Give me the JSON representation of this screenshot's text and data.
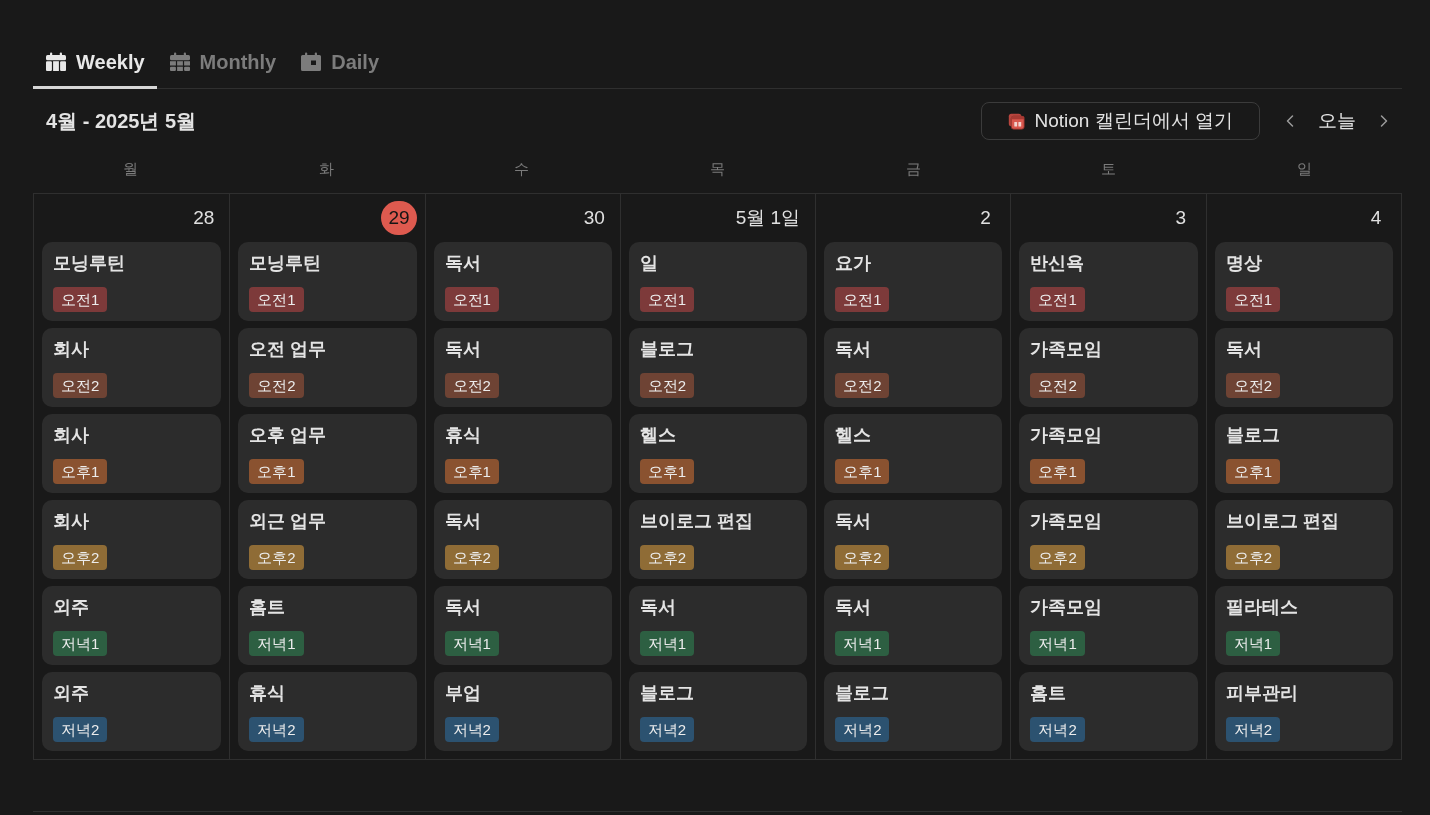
{
  "tabs": [
    {
      "label": "Weekly",
      "selected": true
    },
    {
      "label": "Monthly",
      "selected": false
    },
    {
      "label": "Daily",
      "selected": false
    }
  ],
  "header": {
    "title": "4월 - 2025년 5월",
    "open_button": {
      "label": "Notion 캘린더에서 열기"
    },
    "today_button": {
      "label": "오늘"
    }
  },
  "weekdays": [
    "월",
    "화",
    "수",
    "목",
    "금",
    "토",
    "일"
  ],
  "days": [
    {
      "date": "28",
      "today": false,
      "events": [
        {
          "title": "모닝루틴",
          "tag": {
            "label": "오전1",
            "color": "#7d3a3a"
          }
        },
        {
          "title": "회사",
          "tag": {
            "label": "오전2",
            "color": "#6e4334"
          }
        },
        {
          "title": "회사",
          "tag": {
            "label": "오후1",
            "color": "#8a5230"
          }
        },
        {
          "title": "회사",
          "tag": {
            "label": "오후2",
            "color": "#8f6c36"
          }
        },
        {
          "title": "외주",
          "tag": {
            "label": "저녁1",
            "color": "#2d5f42"
          }
        },
        {
          "title": "외주",
          "tag": {
            "label": "저녁2",
            "color": "#2c5270"
          }
        }
      ]
    },
    {
      "date": "29",
      "today": true,
      "events": [
        {
          "title": "모닝루틴",
          "tag": {
            "label": "오전1",
            "color": "#7d3a3a"
          }
        },
        {
          "title": "오전 업무",
          "tag": {
            "label": "오전2",
            "color": "#6e4334"
          }
        },
        {
          "title": "오후 업무",
          "tag": {
            "label": "오후1",
            "color": "#8a5230"
          }
        },
        {
          "title": "외근 업무",
          "tag": {
            "label": "오후2",
            "color": "#8f6c36"
          }
        },
        {
          "title": "홈트",
          "tag": {
            "label": "저녁1",
            "color": "#2d5f42"
          }
        },
        {
          "title": "휴식",
          "tag": {
            "label": "저녁2",
            "color": "#2c5270"
          }
        }
      ]
    },
    {
      "date": "30",
      "today": false,
      "events": [
        {
          "title": "독서",
          "tag": {
            "label": "오전1",
            "color": "#7d3a3a"
          }
        },
        {
          "title": "독서",
          "tag": {
            "label": "오전2",
            "color": "#6e4334"
          }
        },
        {
          "title": "휴식",
          "tag": {
            "label": "오후1",
            "color": "#8a5230"
          }
        },
        {
          "title": "독서",
          "tag": {
            "label": "오후2",
            "color": "#8f6c36"
          }
        },
        {
          "title": "독서",
          "tag": {
            "label": "저녁1",
            "color": "#2d5f42"
          }
        },
        {
          "title": "부업",
          "tag": {
            "label": "저녁2",
            "color": "#2c5270"
          }
        }
      ]
    },
    {
      "date": "5월 1일",
      "today": false,
      "events": [
        {
          "title": "일",
          "tag": {
            "label": "오전1",
            "color": "#7d3a3a"
          }
        },
        {
          "title": "블로그",
          "tag": {
            "label": "오전2",
            "color": "#6e4334"
          }
        },
        {
          "title": "헬스",
          "tag": {
            "label": "오후1",
            "color": "#8a5230"
          }
        },
        {
          "title": "브이로그 편집",
          "tag": {
            "label": "오후2",
            "color": "#8f6c36"
          }
        },
        {
          "title": "독서",
          "tag": {
            "label": "저녁1",
            "color": "#2d5f42"
          }
        },
        {
          "title": "블로그",
          "tag": {
            "label": "저녁2",
            "color": "#2c5270"
          }
        }
      ]
    },
    {
      "date": "2",
      "today": false,
      "events": [
        {
          "title": "요가",
          "tag": {
            "label": "오전1",
            "color": "#7d3a3a"
          }
        },
        {
          "title": "독서",
          "tag": {
            "label": "오전2",
            "color": "#6e4334"
          }
        },
        {
          "title": "헬스",
          "tag": {
            "label": "오후1",
            "color": "#8a5230"
          }
        },
        {
          "title": "독서",
          "tag": {
            "label": "오후2",
            "color": "#8f6c36"
          }
        },
        {
          "title": "독서",
          "tag": {
            "label": "저녁1",
            "color": "#2d5f42"
          }
        },
        {
          "title": "블로그",
          "tag": {
            "label": "저녁2",
            "color": "#2c5270"
          }
        }
      ]
    },
    {
      "date": "3",
      "today": false,
      "events": [
        {
          "title": "반신욕",
          "tag": {
            "label": "오전1",
            "color": "#7d3a3a"
          }
        },
        {
          "title": "가족모임",
          "tag": {
            "label": "오전2",
            "color": "#6e4334"
          }
        },
        {
          "title": "가족모임",
          "tag": {
            "label": "오후1",
            "color": "#8a5230"
          }
        },
        {
          "title": "가족모임",
          "tag": {
            "label": "오후2",
            "color": "#8f6c36"
          }
        },
        {
          "title": "가족모임",
          "tag": {
            "label": "저녁1",
            "color": "#2d5f42"
          }
        },
        {
          "title": "홈트",
          "tag": {
            "label": "저녁2",
            "color": "#2c5270"
          }
        }
      ]
    },
    {
      "date": "4",
      "today": false,
      "events": [
        {
          "title": "명상",
          "tag": {
            "label": "오전1",
            "color": "#7d3a3a"
          }
        },
        {
          "title": "독서",
          "tag": {
            "label": "오전2",
            "color": "#6e4334"
          }
        },
        {
          "title": "블로그",
          "tag": {
            "label": "오후1",
            "color": "#8a5230"
          }
        },
        {
          "title": "브이로그 편집",
          "tag": {
            "label": "오후2",
            "color": "#8f6c36"
          }
        },
        {
          "title": "필라테스",
          "tag": {
            "label": "저녁1",
            "color": "#2d5f42"
          }
        },
        {
          "title": "피부관리",
          "tag": {
            "label": "저녁2",
            "color": "#2c5270"
          }
        }
      ]
    }
  ]
}
